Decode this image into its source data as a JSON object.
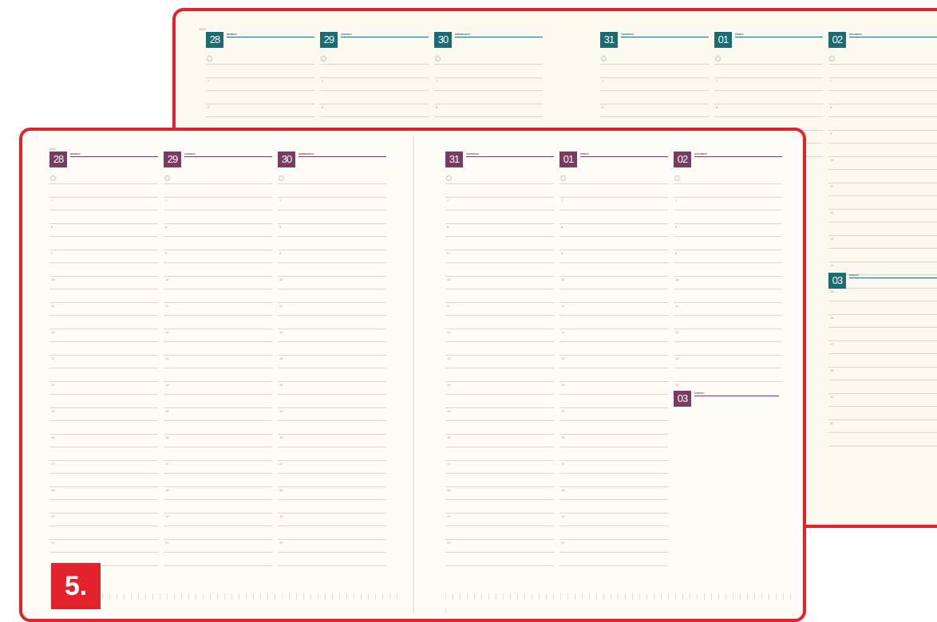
{
  "badge_label": "5.",
  "colors": {
    "frame": "#e3232b",
    "front_accent": "#7a3b63",
    "back_accent": "#1d6b72",
    "badge": "#e3232b"
  },
  "front": {
    "month_label": "MAY",
    "left_days": [
      {
        "date": "28",
        "name": "MONDAY",
        "sub": ""
      },
      {
        "date": "29",
        "name": "TUESDAY",
        "sub": ""
      },
      {
        "date": "30",
        "name": "WEDNESDAY",
        "sub": ""
      }
    ],
    "right_days": [
      {
        "date": "31",
        "name": "THURSDAY",
        "sub": ""
      },
      {
        "date": "01",
        "name": "FRIDAY",
        "sub": ""
      },
      {
        "date": "02",
        "name": "SATURDAY",
        "sub": ""
      }
    ],
    "extra_day": {
      "date": "03",
      "name": "SUNDAY",
      "sub": ""
    },
    "hours": [
      "7",
      "8",
      "9",
      "10",
      "11",
      "12",
      "13",
      "14",
      "15",
      "16",
      "17",
      "18",
      "19",
      "20"
    ],
    "saturday_hours": [
      "7",
      "8",
      "9",
      "10",
      "11",
      "12",
      "13",
      "14",
      "15",
      "16",
      "17",
      "18",
      "19",
      "20"
    ]
  },
  "back": {
    "month_label": "MAY",
    "left_days": [
      {
        "date": "28",
        "name": "MONDAY",
        "sub": ""
      },
      {
        "date": "29",
        "name": "TUESDAY",
        "sub": ""
      },
      {
        "date": "30",
        "name": "WEDNESDAY",
        "sub": ""
      }
    ],
    "right_days": [
      {
        "date": "31",
        "name": "THURSDAY",
        "sub": ""
      },
      {
        "date": "01",
        "name": "FRIDAY",
        "sub": ""
      },
      {
        "date": "02",
        "name": "SATURDAY",
        "sub": ""
      }
    ],
    "extra_day": {
      "date": "03",
      "name": "SUNDAY",
      "sub": ""
    },
    "hours": [
      "7",
      "8",
      "9"
    ],
    "saturday_hours": [
      "7",
      "8",
      "9",
      "10",
      "11",
      "12",
      "13",
      "14",
      "15",
      "16",
      "17",
      "18",
      "19",
      "20"
    ]
  }
}
